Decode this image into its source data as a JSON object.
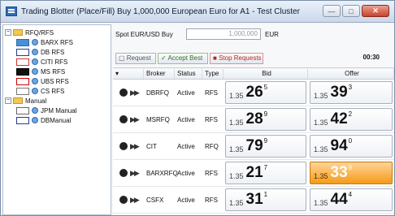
{
  "window": {
    "title": "Trading Blotter (Place/Fill) Buy 1,000,000 European Euro for A1 - Test Cluster"
  },
  "tree": {
    "groups": [
      {
        "label": "RFQ/RFS",
        "items": [
          "BARX RFS",
          "DB RFS",
          "CITI RFS",
          "MS RFS",
          "UBS RFS",
          "CS RFS"
        ]
      },
      {
        "label": "Manual",
        "items": [
          "JPM Manual",
          "DBManual"
        ]
      }
    ]
  },
  "order": {
    "spot_label": "Spot EUR/USD  Buy",
    "amount": "1,000,000",
    "currency": "EUR",
    "timer": "00:30"
  },
  "buttons": {
    "request": "Request",
    "accept_best": "Accept Best",
    "stop_requests": "Stop Requests"
  },
  "columns": {
    "broker": "Broker",
    "status": "Status",
    "type": "Type",
    "bid": "Bid",
    "offer": "Offer"
  },
  "rows": [
    {
      "broker": "DBRFQ",
      "status": "Active",
      "type": "RFS",
      "bid": {
        "small": "1.35",
        "big": "26",
        "sup": "5"
      },
      "offer": {
        "small": "1.35",
        "big": "39",
        "sup": "3"
      }
    },
    {
      "broker": "MSRFQ",
      "status": "Active",
      "type": "RFS",
      "bid": {
        "small": "1.35",
        "big": "28",
        "sup": "9"
      },
      "offer": {
        "small": "1.35",
        "big": "42",
        "sup": "2"
      }
    },
    {
      "broker": "CIT",
      "status": "Active",
      "type": "RFQ",
      "bid": {
        "small": "1.35",
        "big": "79",
        "sup": "9"
      },
      "offer": {
        "small": "1.35",
        "big": "94",
        "sup": "0"
      }
    },
    {
      "broker": "BARXRFQ",
      "status": "Active",
      "type": "RFS",
      "bid": {
        "small": "1.35",
        "big": "21",
        "sup": "7"
      },
      "offer": {
        "small": "1.35",
        "big": "33",
        "sup": "9"
      }
    },
    {
      "broker": "CSFX",
      "status": "Active",
      "type": "RFS",
      "bid": {
        "small": "1.35",
        "big": "31",
        "sup": "1"
      },
      "offer": {
        "small": "1.35",
        "big": "44",
        "sup": "4"
      }
    }
  ],
  "colors": {
    "highlight": "#f59b16"
  }
}
